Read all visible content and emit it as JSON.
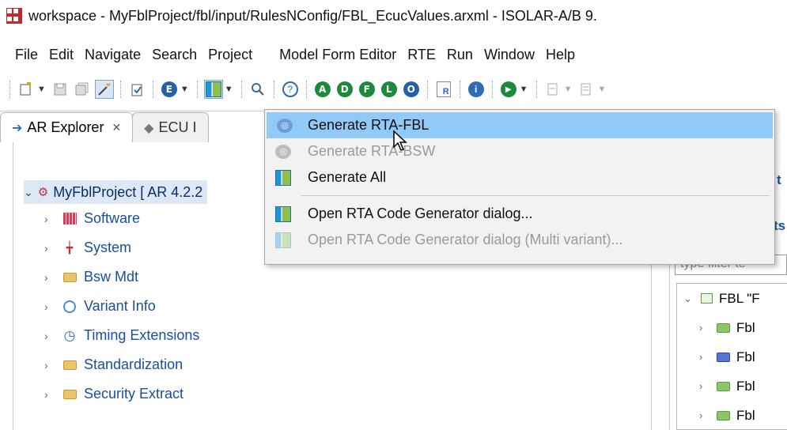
{
  "window": {
    "title": "workspace - MyFblProject/fbl/input/RulesNConfig/FBL_EcucValues.arxml - ISOLAR-A/B 9."
  },
  "menubar": {
    "items": [
      "File",
      "Edit",
      "Navigate",
      "Search",
      "Project",
      "Model Form Editor",
      "RTE",
      "Run",
      "Window",
      "Help"
    ]
  },
  "toolbar": {
    "circle_buttons": [
      "A",
      "D",
      "F",
      "L",
      "O"
    ],
    "r_icon": "R",
    "info_icon": "i",
    "e_icon": "E",
    "help_icon": "?"
  },
  "tabs": [
    {
      "label": "AR Explorer",
      "active": true
    },
    {
      "label": "ECU I",
      "active": false
    }
  ],
  "tree": {
    "root": {
      "label": "MyFblProject [ AR 4.2.2"
    },
    "children": [
      {
        "label": "Software",
        "icon": "software-icon"
      },
      {
        "label": "System",
        "icon": "system-icon"
      },
      {
        "label": "Bsw Mdt",
        "icon": "folder-icon"
      },
      {
        "label": "Variant Info",
        "icon": "variant-icon"
      },
      {
        "label": "Timing Extensions",
        "icon": "clock-icon"
      },
      {
        "label": "Standardization",
        "icon": "folder-icon"
      },
      {
        "label": "Security Extract",
        "icon": "folder-icon"
      }
    ]
  },
  "dropdown": {
    "items": [
      {
        "label": "Generate RTA-FBL",
        "enabled": true,
        "hover": true
      },
      {
        "label": "Generate RTA-BSW",
        "enabled": false
      },
      {
        "label": "Generate All",
        "enabled": true
      },
      {
        "label": "Open RTA Code Generator dialog...",
        "enabled": true
      },
      {
        "label": "Open RTA Code Generator dialog (Multi variant)...",
        "enabled": false
      }
    ]
  },
  "right_panel": {
    "frag_top": "t",
    "frag_mid": "ts",
    "filter_placeholder": "type filter te",
    "tree_root": "FBL \"F",
    "tree_items": [
      "Fbl",
      "Fbl",
      "Fbl",
      "Fbl"
    ]
  },
  "colors": {
    "menu_hover": "#91c9f7",
    "tree_selected": "#dde8f6",
    "link_text": "#1a4fa0",
    "toolbar_green": "#1b8a3a"
  }
}
